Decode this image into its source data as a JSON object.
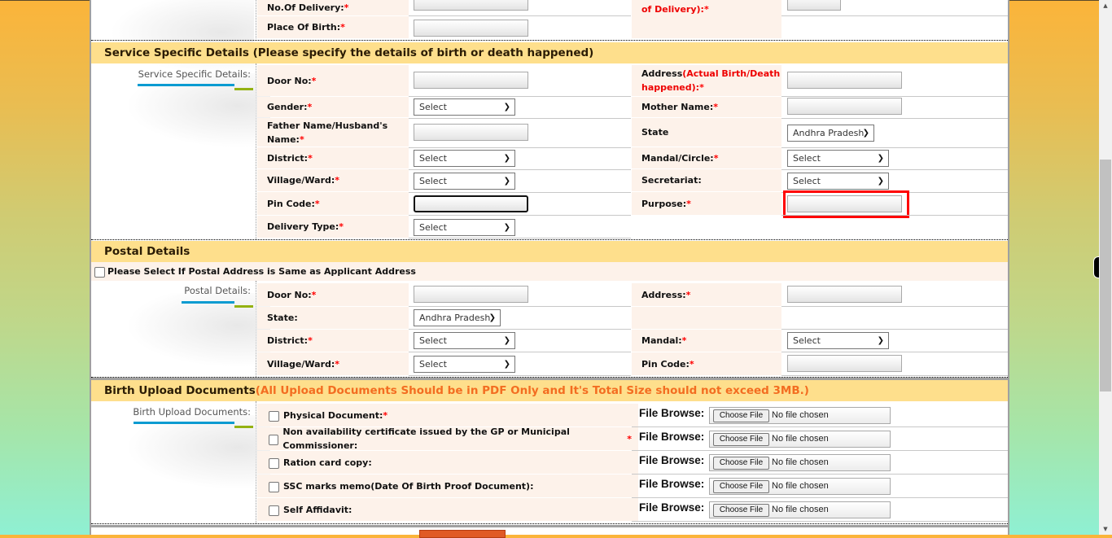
{
  "top_rows": {
    "no_of_delivery": {
      "label": "No.Of Delivery:",
      "required": "*"
    },
    "place_of_birth": {
      "label": "Place Of Birth:",
      "required": "*"
    },
    "right_label_partial": "of Delivery):"
  },
  "service_section": {
    "title": "Service Specific Details (Please specify the details of birth or death happened)",
    "side_label": "Service Specific Details:",
    "fields": {
      "door_no": {
        "label": "Door No:",
        "required": "*"
      },
      "address_prefix": "Address",
      "address_note": "(Actual Birth/Death happened):",
      "gender": {
        "label": "Gender:",
        "required": "*",
        "value": "Select"
      },
      "mother_name": {
        "label": "Mother Name:",
        "required": "*"
      },
      "father_name": {
        "label": "Father Name/Husband's Name:",
        "required": "*"
      },
      "state": {
        "label": "State",
        "value": "Andhra Pradesh"
      },
      "district": {
        "label": "District:",
        "required": "*",
        "value": "Select"
      },
      "mandal": {
        "label": "Mandal/Circle:",
        "required": "*",
        "value": "Select"
      },
      "village": {
        "label": "Village/Ward:",
        "required": "*",
        "value": "Select"
      },
      "secretariat": {
        "label": "Secretariat:",
        "value": "Select"
      },
      "pin_code": {
        "label": "Pin Code:",
        "required": "*"
      },
      "purpose": {
        "label": "Purpose:",
        "required": "*"
      },
      "delivery_type": {
        "label": "Delivery Type:",
        "required": "*",
        "value": "Select"
      }
    }
  },
  "postal_section": {
    "title": "Postal Details",
    "same_address_checkbox": "Please Select If Postal Address is Same as Applicant Address",
    "side_label": "Postal Details:",
    "fields": {
      "door_no": {
        "label": "Door No:",
        "required": "*"
      },
      "address": {
        "label": "Address:",
        "required": "*"
      },
      "state": {
        "label": "State:",
        "value": "Andhra Pradesh"
      },
      "district": {
        "label": "District:",
        "required": "*",
        "value": "Select"
      },
      "mandal": {
        "label": "Mandal:",
        "required": "*",
        "value": "Select"
      },
      "village": {
        "label": "Village/Ward:",
        "required": "*",
        "value": "Select"
      },
      "pin_code": {
        "label": "Pin Code:",
        "required": "*"
      }
    }
  },
  "upload_section": {
    "title": "Birth Upload Documents",
    "note": "(All Upload Documents Should be in PDF Only and It's Total Size should not exceed 3MB.)",
    "side_label": "Birth Upload Documents:",
    "file_browse_label": "File Browse:",
    "choose_file_label": "Choose File",
    "no_file_label": "No file chosen",
    "documents": [
      {
        "label": "Physical Document:",
        "required": "*"
      },
      {
        "label": "Non availability certificate issued by the GP or Municipal Commissioner:",
        "required": "*"
      },
      {
        "label": "Ration card copy:",
        "required": ""
      },
      {
        "label": "SSC marks memo(Date Of Birth Proof Document):",
        "required": ""
      },
      {
        "label": "Self Affidavit:",
        "required": ""
      }
    ]
  },
  "colors": {
    "section_header_bg": "#fedf8c",
    "label_bg": "#fdf2ea",
    "required": "#ff0000",
    "note_orange": "#f36d21",
    "highlight": "#ff0000",
    "accent_blue": "#0a9bd1",
    "accent_green": "#94b212"
  },
  "icons": {
    "dropdown": "chevron-down-icon",
    "scroll_up": "scroll-up-arrow",
    "scroll_down": "scroll-down-arrow"
  }
}
